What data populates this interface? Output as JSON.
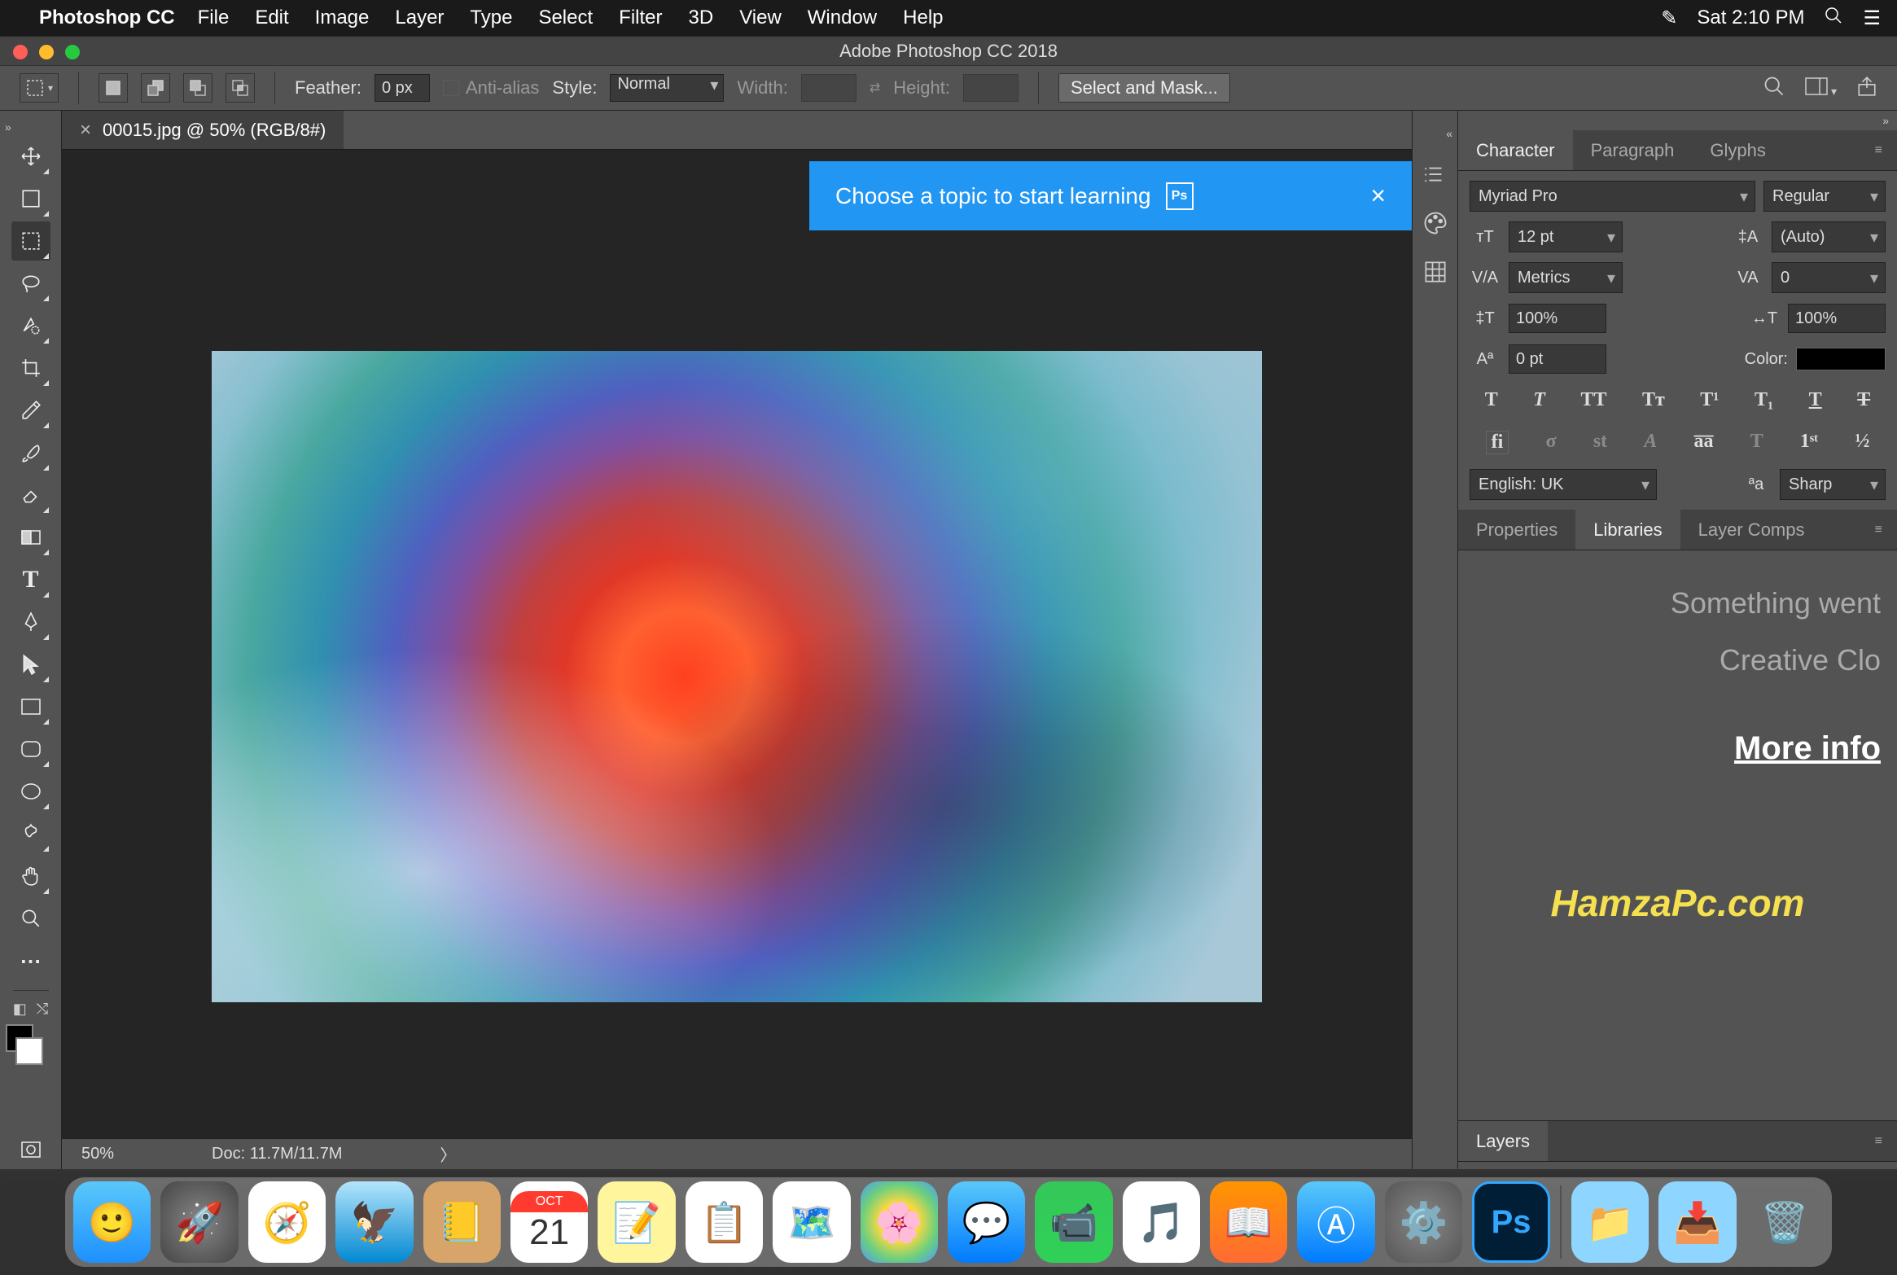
{
  "menubar": {
    "app_name": "Photoshop CC",
    "items": [
      "File",
      "Edit",
      "Image",
      "Layer",
      "Type",
      "Select",
      "Filter",
      "3D",
      "View",
      "Window",
      "Help"
    ],
    "datetime": "Sat 2:10 PM"
  },
  "window": {
    "title": "Adobe Photoshop CC 2018"
  },
  "options_bar": {
    "feather_label": "Feather:",
    "feather_value": "0 px",
    "anti_alias_label": "Anti-alias",
    "style_label": "Style:",
    "style_value": "Normal",
    "width_label": "Width:",
    "width_value": "",
    "height_label": "Height:",
    "height_value": "",
    "select_mask_label": "Select and Mask..."
  },
  "tools": [
    "move-tool",
    "artboard-tool",
    "rectangular-marquee-tool",
    "lasso-tool",
    "quick-selection-tool",
    "crop-tool",
    "eyedropper-tool",
    "brush-tool",
    "eraser-tool",
    "gradient-tool",
    "type-tool",
    "pen-tool",
    "path-selection-tool",
    "rectangle-tool",
    "rounded-rectangle-tool",
    "ellipse-tool",
    "custom-shape-tool",
    "hand-tool",
    "zoom-tool",
    "more-tools"
  ],
  "document": {
    "tab_title": "00015.jpg @ 50% (RGB/8#)",
    "learning_tooltip": "Choose a topic to start learning",
    "zoom": "50%",
    "doc_size": "Doc: 11.7M/11.7M"
  },
  "right_strip_icons": [
    "history-icon",
    "color-palette-icon",
    "grid-icon"
  ],
  "panels": {
    "char_tabs": {
      "character": "Character",
      "paragraph": "Paragraph",
      "glyphs": "Glyphs"
    },
    "character": {
      "font_family": "Myriad Pro",
      "font_style": "Regular",
      "font_size": "12 pt",
      "leading": "(Auto)",
      "kerning": "Metrics",
      "tracking": "0",
      "vert_scale": "100%",
      "horiz_scale": "100%",
      "baseline_shift": "0 pt",
      "color_label": "Color:",
      "language": "English: UK",
      "anti_alias": "Sharp"
    },
    "lib_tabs": {
      "properties": "Properties",
      "libraries": "Libraries",
      "layer_comps": "Layer Comps"
    },
    "libraries": {
      "error_line1": "Something went",
      "error_line2": "Creative Clo",
      "more_info": "More info",
      "watermark": "HamzaPc.com"
    },
    "layers_tab": "Layers"
  },
  "dock": {
    "apps": [
      "finder",
      "launchpad",
      "safari",
      "mail",
      "contacts",
      "calendar",
      "notes",
      "reminders",
      "maps",
      "photos",
      "messages",
      "facetime",
      "itunes",
      "ibooks",
      "appstore",
      "system-preferences",
      "photoshop"
    ],
    "right": [
      "applications-folder",
      "downloads-folder",
      "trash"
    ],
    "calendar_day": "21",
    "calendar_month": "OCT"
  }
}
